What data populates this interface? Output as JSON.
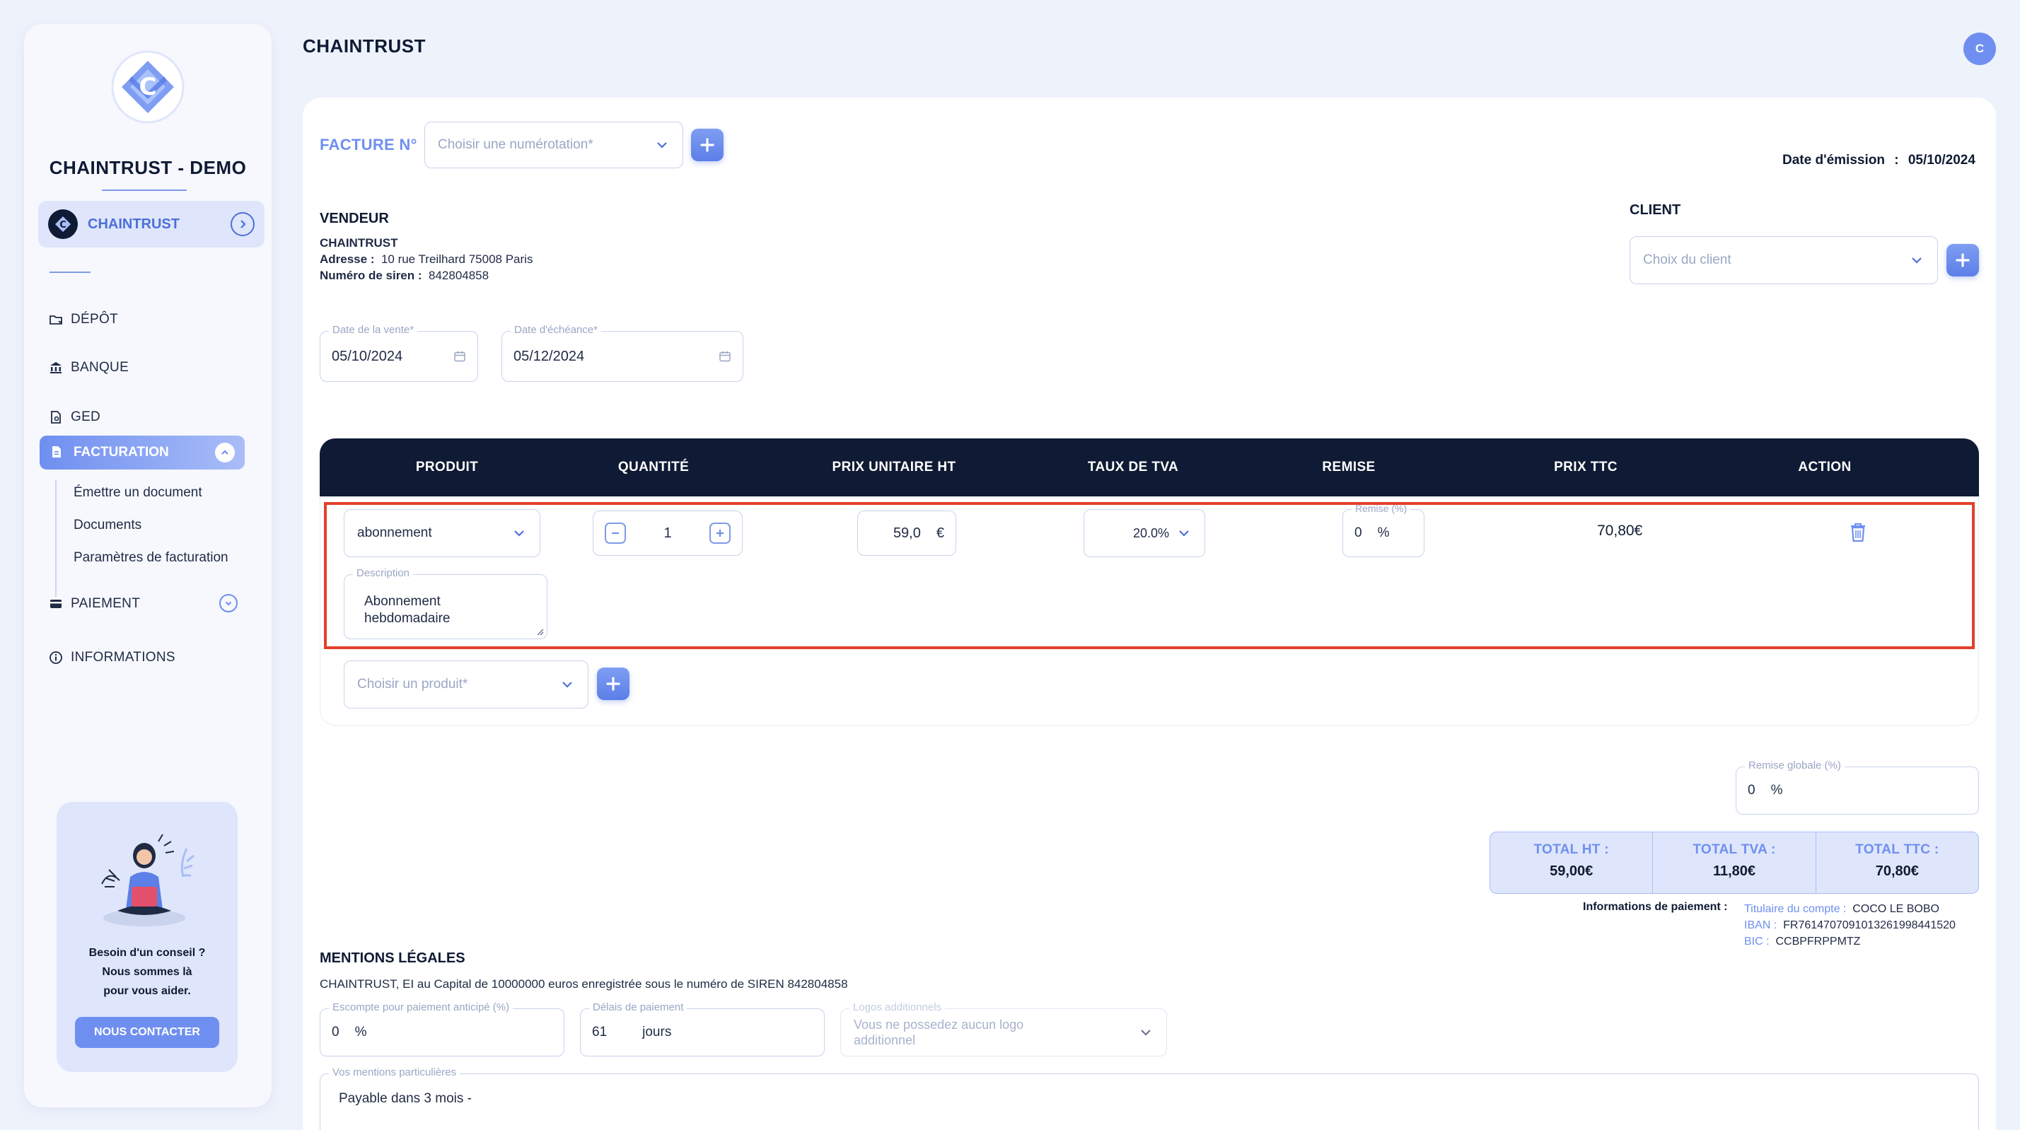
{
  "sidebar": {
    "org_name": "CHAINTRUST - DEMO",
    "company": "CHAINTRUST",
    "nav": {
      "depot": "DÉPÔT",
      "banque": "BANQUE",
      "ged": "GED",
      "facturation": "FACTURATION",
      "paiement": "PAIEMENT",
      "informations": "INFORMATIONS"
    },
    "facturation_sub": [
      "Émettre un document",
      "Documents",
      "Paramètres de facturation"
    ],
    "help": {
      "line1": "Besoin d'un conseil ?",
      "line2": "Nous sommes là",
      "line3": "pour vous aider.",
      "button": "NOUS CONTACTER"
    }
  },
  "header": {
    "title": "CHAINTRUST",
    "avatar_initial": "C"
  },
  "invoice": {
    "number_label": "FACTURE N°",
    "numbering_placeholder": "Choisir une numérotation*",
    "emission_label": "Date d'émission",
    "emission_sep": ":",
    "emission_date": "05/10/2024",
    "vendor_title": "VENDEUR",
    "vendor_name": "CHAINTRUST",
    "vendor_address_label": "Adresse :",
    "vendor_address": "10 rue Treilhard 75008 Paris",
    "vendor_siren_label": "Numéro de siren :",
    "vendor_siren": "842804858",
    "client_title": "CLIENT",
    "client_placeholder": "Choix du client",
    "sale_date_label": "Date de la vente*",
    "sale_date": "05/10/2024",
    "due_date_label": "Date d'échéance*",
    "due_date": "05/12/2024"
  },
  "table": {
    "headers": [
      "PRODUIT",
      "QUANTITÉ",
      "PRIX UNITAIRE HT",
      "TAUX DE TVA",
      "REMISE",
      "PRIX TTC",
      "ACTION"
    ],
    "row": {
      "product": "abonnement",
      "quantity": "1",
      "unit_price": "59,0",
      "currency": "€",
      "vat": "20.0%",
      "discount_label": "Remise (%)",
      "discount": "0",
      "percent": "%",
      "price_ttc": "70,80€",
      "description_label": "Description",
      "description_line1": "Abonnement",
      "description_line2": "hebdomadaire"
    },
    "add_product_placeholder": "Choisir un produit*"
  },
  "global_discount": {
    "label": "Remise globale (%)",
    "value": "0",
    "percent": "%"
  },
  "totals": [
    {
      "label": "TOTAL HT :",
      "value": "59,00€"
    },
    {
      "label": "TOTAL TVA :",
      "value": "11,80€"
    },
    {
      "label": "TOTAL TTC :",
      "value": "70,80€"
    }
  ],
  "payment_info": {
    "title": "Informations de paiement :",
    "holder_label": "Titulaire du compte :",
    "holder": "COCO LE BOBO",
    "iban_label": "IBAN :",
    "iban": "FR7614707091013261998441520",
    "bic_label": "BIC :",
    "bic": "CCBPFRPPMTZ"
  },
  "legal": {
    "title": "MENTIONS LÉGALES",
    "text": "CHAINTRUST, EI au Capital de 10000000 euros enregistrée sous le numéro de SIREN 842804858",
    "escompte_label": "Escompte pour paiement anticipé (%)",
    "escompte_value": "0",
    "percent": "%",
    "delay_label": "Délais de paiement",
    "delay_value": "61",
    "delay_unit": "jours",
    "logos_label": "Logos additionnels",
    "logos_placeholder_line1": "Vous ne possedez aucun logo",
    "logos_placeholder_line2": "additionnel",
    "mentions_label": "Vos mentions particulières",
    "mentions_value": "Payable dans 3 mois -"
  },
  "colors": {
    "accent": "#6f8ff0",
    "dark": "#0f1b34",
    "highlight": "#e2402b",
    "background": "#eef2fb"
  }
}
